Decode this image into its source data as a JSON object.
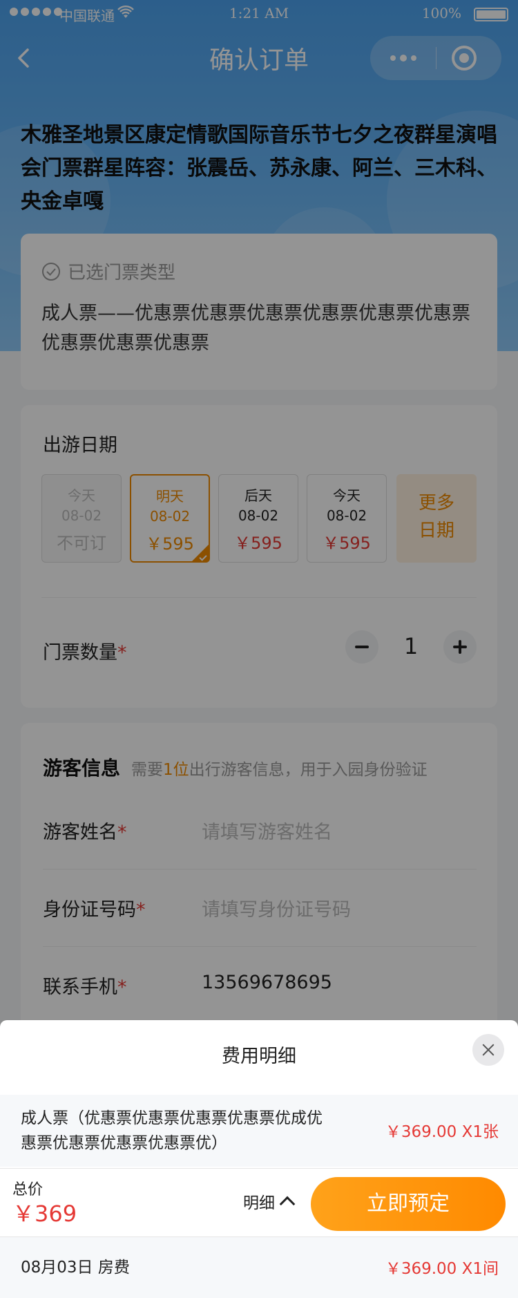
{
  "status_bar": {
    "carrier": "中国联通",
    "time": "1:21 AM",
    "battery": "100%"
  },
  "nav": {
    "title": "确认订单"
  },
  "event": {
    "title": "木雅圣地景区康定情歌国际音乐节七夕之夜群星演唱会门票群星阵容：张震岳、苏永康、阿兰、三木科、央金卓嘎"
  },
  "selected_ticket": {
    "heading": "已选门票类型",
    "description": "成人票——优惠票优惠票优惠票优惠票优惠票优惠票优惠票优惠票优惠票"
  },
  "travel_date": {
    "label": "出游日期",
    "options": [
      {
        "day": "今天",
        "date": "08-02",
        "price": "不可订"
      },
      {
        "day": "明天",
        "date": "08-02",
        "price": "￥595"
      },
      {
        "day": "后天",
        "date": "08-02",
        "price": "￥595"
      },
      {
        "day": "今天",
        "date": "08-02",
        "price": "￥595"
      }
    ],
    "more_line1": "更多",
    "more_line2": "日期"
  },
  "quantity": {
    "label": "门票数量",
    "required_mark": "*",
    "value": "1"
  },
  "visitor": {
    "heading": "游客信息",
    "hint_prefix": "需要",
    "hint_count": "1位",
    "hint_suffix": "出行游客信息，用于入园身份验证",
    "fields": [
      {
        "label": "游客姓名",
        "placeholder": "请填写游客姓名"
      },
      {
        "label": "身份证号码",
        "placeholder": "请填写身份证号码"
      },
      {
        "label": "联系手机",
        "value": "13569678695"
      }
    ]
  },
  "fee_sheet": {
    "title": "费用明细",
    "rows": [
      {
        "name": "成人票（优惠票优惠票优惠票优惠票优成优惠票优惠票优惠票优惠票优）",
        "price": "￥369.00  X1张"
      },
      {
        "name": "08月03日  房费",
        "price": "￥369.00  X1间"
      }
    ]
  },
  "footer": {
    "total_label": "总价",
    "total_price": "￥369",
    "detail_label": "明细",
    "book_label": "立即预定"
  },
  "colors": {
    "primary_blue": "#4da3ef",
    "accent_orange": "#f08a00",
    "price_red": "#e53935"
  }
}
